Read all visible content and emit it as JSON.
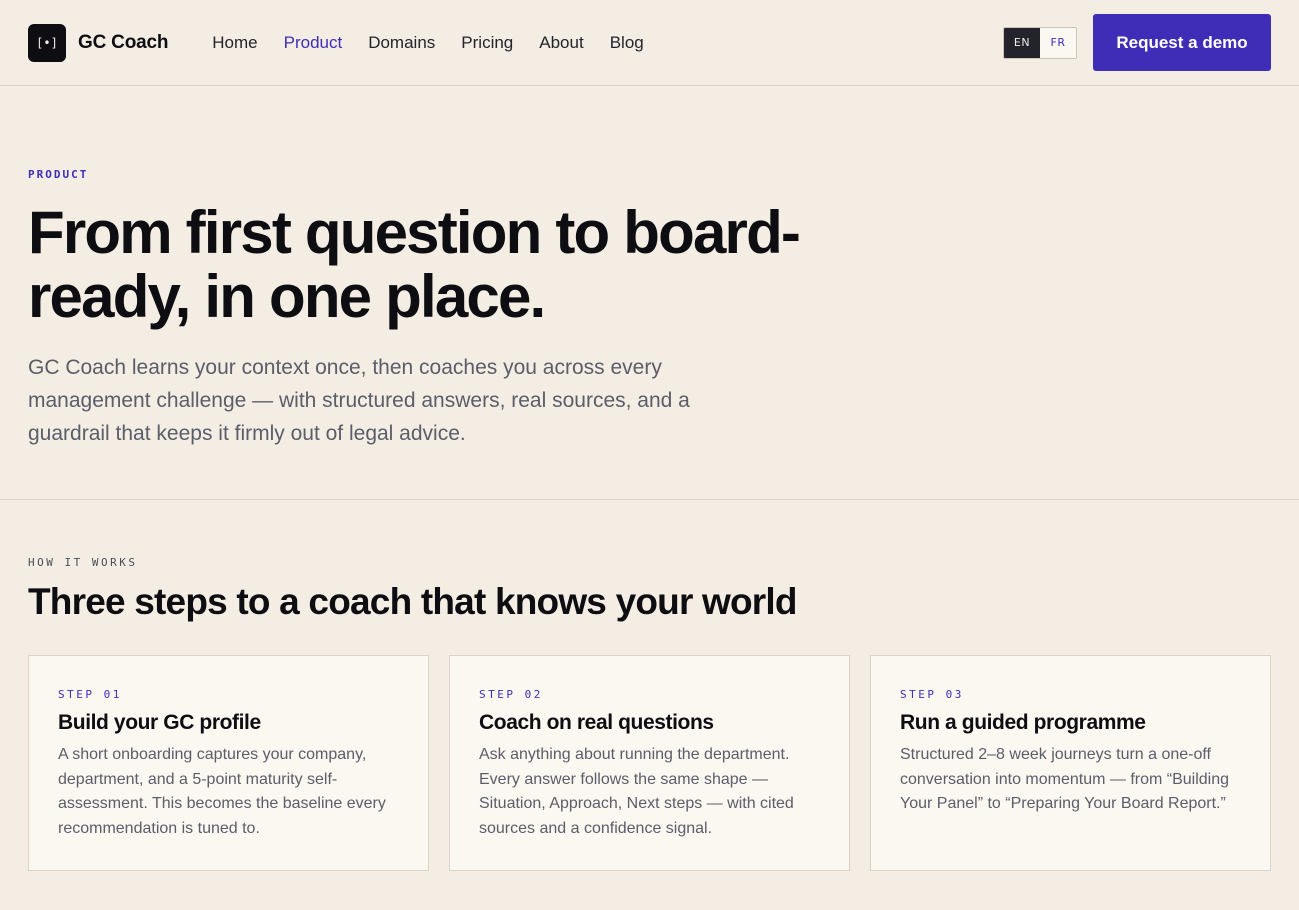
{
  "header": {
    "logo_glyph": "[•]",
    "brand": "GC Coach",
    "nav": [
      {
        "label": "Home",
        "active": false
      },
      {
        "label": "Product",
        "active": true
      },
      {
        "label": "Domains",
        "active": false
      },
      {
        "label": "Pricing",
        "active": false
      },
      {
        "label": "About",
        "active": false
      },
      {
        "label": "Blog",
        "active": false
      }
    ],
    "lang": {
      "en": "EN",
      "fr": "FR",
      "selected": "EN"
    },
    "cta": "Request a demo"
  },
  "hero": {
    "eyebrow": "PRODUCT",
    "title": "From first question to board-ready, in one place.",
    "lead": "GC Coach learns your context once, then coaches you across every management challenge — with structured answers, real sources, and a guardrail that keeps it firmly out of legal advice."
  },
  "how": {
    "eyebrow": "HOW IT WORKS",
    "title": "Three steps to a coach that knows your world",
    "steps": [
      {
        "step": "STEP 01",
        "title": "Build your GC profile",
        "body": "A short onboarding captures your company, department, and a 5-point maturity self-assessment. This becomes the baseline every recommendation is tuned to."
      },
      {
        "step": "STEP 02",
        "title": "Coach on real questions",
        "body": "Ask anything about running the department. Every answer follows the same shape — Situation, Approach, Next steps — with cited sources and a confidence signal."
      },
      {
        "step": "STEP 03",
        "title": "Run a guided programme",
        "body": "Structured 2–8 week journeys turn a one-off conversation into momentum — from “Building Your Panel” to “Preparing Your Board Report.”"
      }
    ]
  },
  "colors": {
    "accent": "#3f2db8",
    "background": "#f4ede3",
    "card": "#fbf7f1",
    "ink": "#0d0d12"
  }
}
